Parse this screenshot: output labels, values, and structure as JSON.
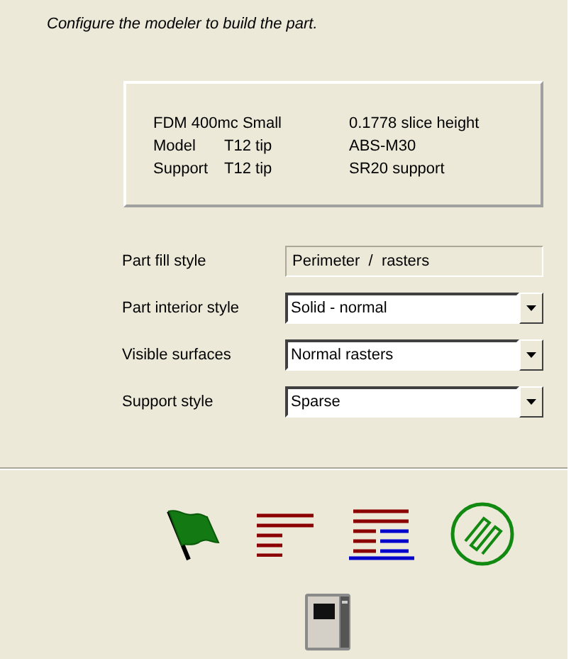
{
  "instruction": "Configure the modeler to build the part.",
  "info": [
    [
      "FDM 400mc Small",
      "0.1778 slice height"
    ],
    [
      "Model",
      "T12 tip",
      "ABS-M30"
    ],
    [
      "Support",
      "T12 tip",
      "SR20 support"
    ]
  ],
  "settings": [
    {
      "label": "Part fill style",
      "kind": "readonly",
      "value": "Perimeter  /  rasters"
    },
    {
      "label": "Part interior style",
      "kind": "dropdown",
      "value": "Solid - normal"
    },
    {
      "label": "Visible surfaces",
      "kind": "dropdown",
      "value": "Normal rasters"
    },
    {
      "label": "Support style",
      "kind": "dropdown",
      "value": "Sparse"
    }
  ]
}
